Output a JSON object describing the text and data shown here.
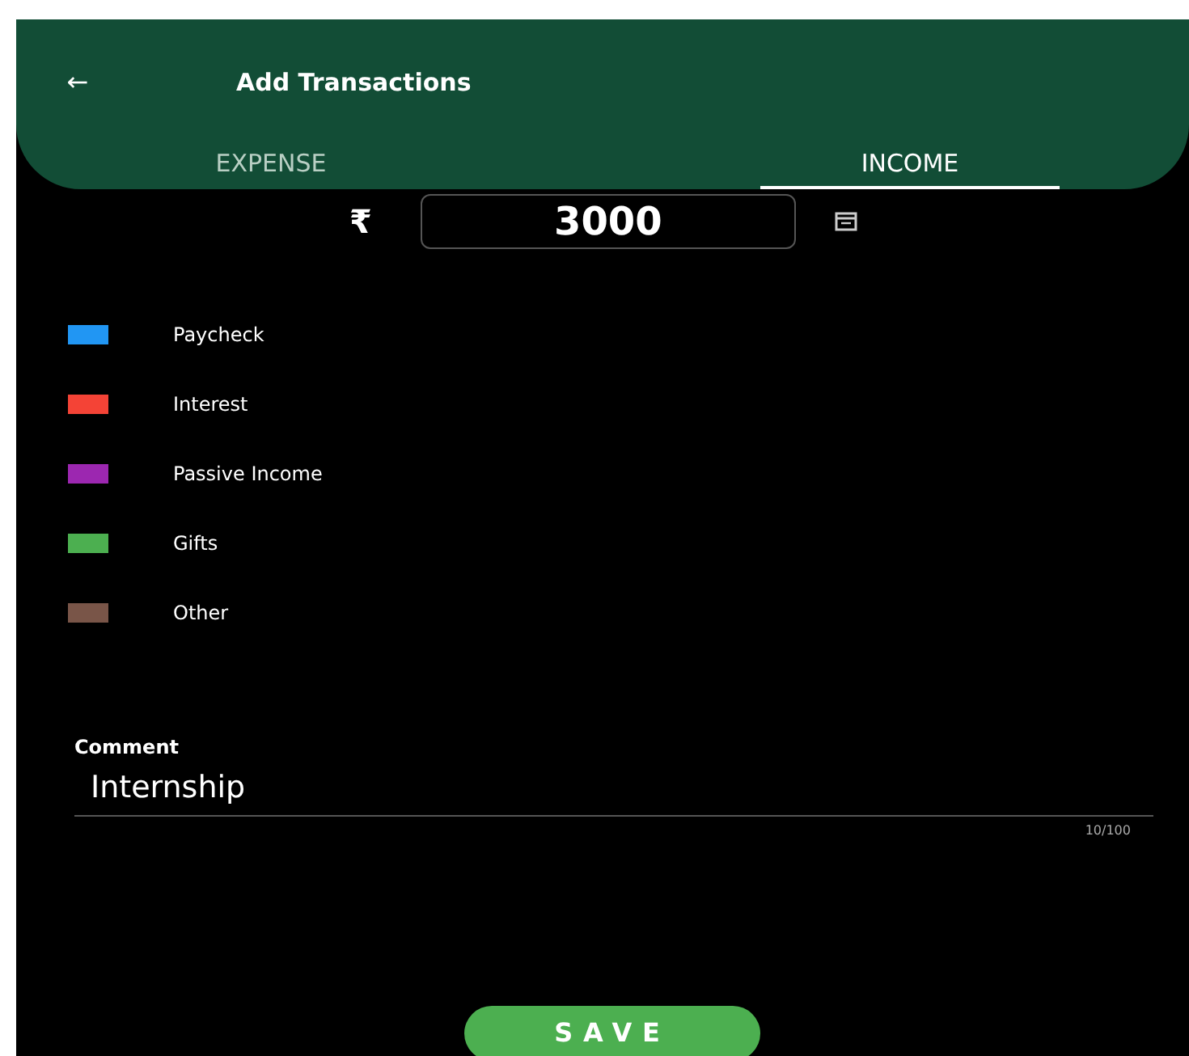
{
  "header": {
    "title": "Add Transactions",
    "back_icon": "←"
  },
  "tabs": [
    {
      "label": "EXPENSE",
      "selected": false
    },
    {
      "label": "INCOME",
      "selected": true
    }
  ],
  "amount": {
    "currency": "₹",
    "value": "3000"
  },
  "categories": [
    {
      "label": "Paycheck",
      "color": "#2196f3"
    },
    {
      "label": "Interest",
      "color": "#f44336"
    },
    {
      "label": "Passive Income",
      "color": "#9c27b0"
    },
    {
      "label": "Gifts",
      "color": "#4caf50"
    },
    {
      "label": "Other",
      "color": "#795548"
    }
  ],
  "comment": {
    "label": "Comment",
    "value": "Internship",
    "counter": "10/100"
  },
  "save_button": "SAVE"
}
